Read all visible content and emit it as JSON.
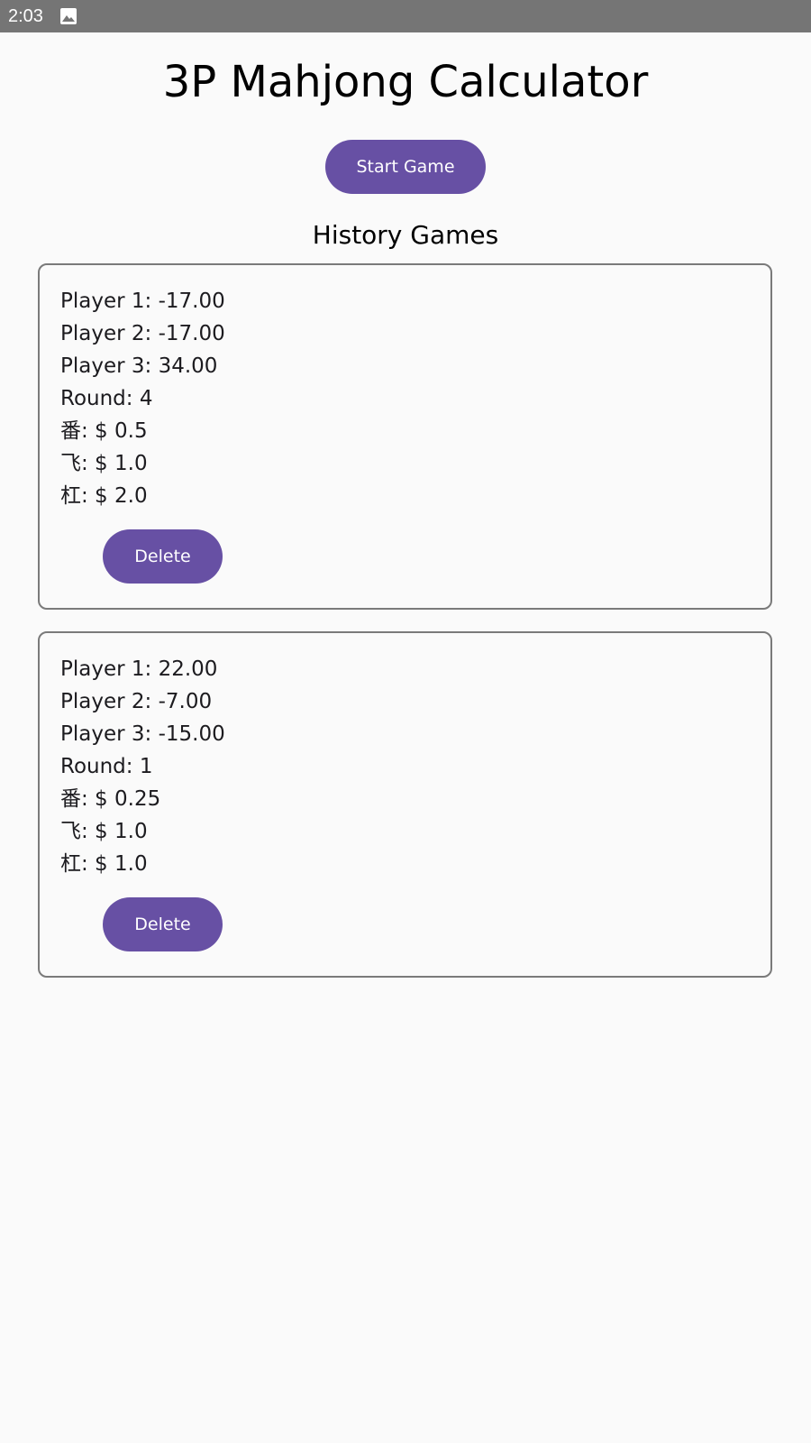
{
  "status_bar": {
    "time": "2:03",
    "icon": "image-icon"
  },
  "title": "3P Mahjong Calculator",
  "start_button_label": "Start Game",
  "history_title": "History Games",
  "games": [
    {
      "player1": "Player 1: -17.00",
      "player2": "Player 2: -17.00",
      "player3": "Player 3: 34.00",
      "round": "Round: 4",
      "fan": "番: $ 0.5",
      "fei": "飞: $ 1.0",
      "gang": "杠: $ 2.0",
      "delete_label": "Delete"
    },
    {
      "player1": "Player 1: 22.00",
      "player2": "Player 2: -7.00",
      "player3": "Player 3: -15.00",
      "round": "Round: 1",
      "fan": "番: $ 0.25",
      "fei": "飞: $ 1.0",
      "gang": "杠: $ 1.0",
      "delete_label": "Delete"
    }
  ],
  "colors": {
    "accent": "#6750a4",
    "status_bar": "#757575",
    "background": "#fafafa",
    "card_border": "#7a7a7a"
  }
}
